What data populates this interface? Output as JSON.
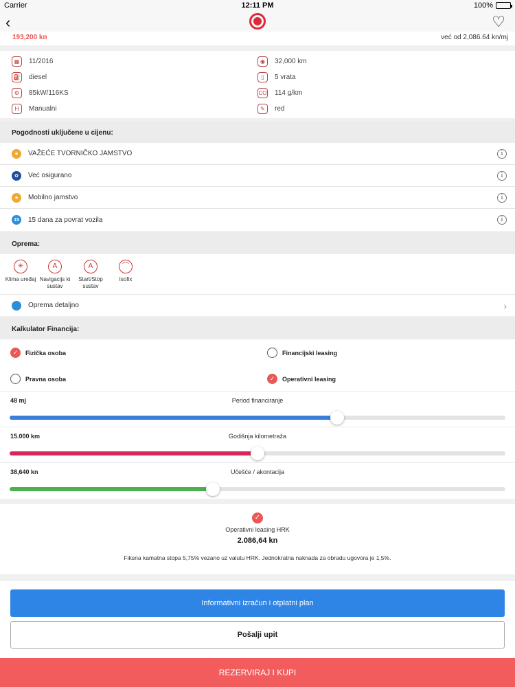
{
  "statusbar": {
    "carrier": "Carrier",
    "time": "12:11 PM",
    "battery": "100%"
  },
  "header": {
    "price": "193,200 kn",
    "monthly": "već od 2,086.64 kn/mj"
  },
  "specs": [
    {
      "icon": "calendar-icon",
      "value": "11/2016"
    },
    {
      "icon": "odometer-icon",
      "value": "32,000 km"
    },
    {
      "icon": "fuel-icon",
      "value": "diesel"
    },
    {
      "icon": "door-icon",
      "value": "5 vrata"
    },
    {
      "icon": "engine-icon",
      "value": "85kW/116KS"
    },
    {
      "icon": "co2-icon",
      "value": "114 g/km"
    },
    {
      "icon": "gearbox-icon",
      "value": "Manualni"
    },
    {
      "icon": "paint-icon",
      "value": "red"
    }
  ],
  "benefits": {
    "title": "Pogodnosti uključene u cijenu:",
    "items": [
      {
        "label": "VAŽEĆE TVORNIČKO JAMSTVO",
        "color": "#f0a830",
        "glyph": "★"
      },
      {
        "label": "Već osigurano",
        "color": "#1f4e9b",
        "glyph": "✿"
      },
      {
        "label": "Mobilno jamstvo",
        "color": "#f0a830",
        "glyph": "★"
      },
      {
        "label": "15 dana za povrat vozila",
        "color": "#2a8ed8",
        "glyph": "15"
      }
    ]
  },
  "equipment": {
    "title": "Oprema:",
    "items": [
      {
        "label": "Klima uređaj",
        "glyph": "✳"
      },
      {
        "label": "Navigacijs ki sustav",
        "glyph": "A"
      },
      {
        "label": "Start/Stop sustav",
        "glyph": "A"
      },
      {
        "label": "Isofix",
        "glyph": "⌒"
      }
    ],
    "detail_label": "Oprema detaljno"
  },
  "calculator": {
    "title": "Kalkulator Financija:",
    "options": [
      {
        "label": "Fizička osoba",
        "checked": true
      },
      {
        "label": "Financijski leasing",
        "checked": false
      },
      {
        "label": "Pravna osoba",
        "checked": false
      },
      {
        "label": "Operativni leasing",
        "checked": true
      }
    ],
    "sliders": [
      {
        "value": "48 mj",
        "label": "Period financiranje",
        "fraction": 0.66,
        "color": "#3a7fd5"
      },
      {
        "value": "15.000 km",
        "label": "Godišnja kilometraža",
        "fraction": 0.5,
        "color": "#d8285a"
      },
      {
        "value": "38,640 kn",
        "label": "Učešće / akontacija",
        "fraction": 0.41,
        "color": "#4caf50"
      }
    ]
  },
  "result": {
    "title": "Operativni leasing HRK",
    "amount": "2.086,64 kn",
    "note": "Fiksna kamatna stopa 5,75% vezano uz valutu HRK. Jednokratna naknada za obradu ugovora je 1,5%."
  },
  "buttons": {
    "plan": "Informativni izračun i otplatni plan",
    "inquiry": "Pošalji upit",
    "reserve": "REZERVIRAJ I KUPI"
  }
}
